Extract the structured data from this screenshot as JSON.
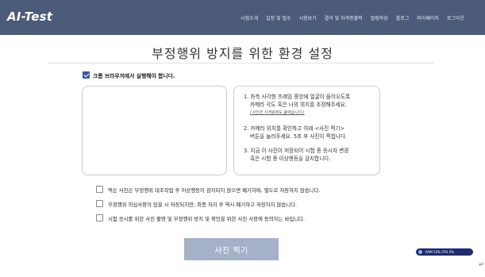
{
  "header": {
    "logo": "AI-Test",
    "nav": [
      "시험소개",
      "일정 및 접수",
      "시험보기",
      "결과 및 자격증출력",
      "알림마당",
      "블로그",
      "마이페이지",
      "로그아웃"
    ]
  },
  "page_title": "부정행위 방지를 위한 환경 설정",
  "browser_notice": {
    "label": "크롬 브라우저에서 실행해야 합니다.",
    "checked": true
  },
  "instructions": {
    "step1": "1. 좌측 사각형 프레임 중앙에 얼굴이 들어오도록",
    "step1b": "카메라 각도 혹은 나의 위치를 조정해주세요.",
    "step1_note": "(사진은 자격증에도 출력됩니다.)",
    "step2": "2. 카메라 위치를 확인하고 아래 <사진 찍기>",
    "step2b": "버튼을 눌러주세요. 5초 후 사진이 찍힙니다.",
    "step3": "3. 지금 이 사진이 저장되어 시험 중 응시자 변경",
    "step3b": "혹은 시험 중 이상행동을 감지합니다."
  },
  "agreements": [
    {
      "label": "찍은 사진은 부정행위 대조작업 후 이상행동이 감지되지 않으면 폐기하며, 별도로 저장하지 않습니다.",
      "checked": false
    },
    {
      "label": "부정행위 의심사항이 있을 시 저장되지만, 최종 처리 후 역시 폐기하고 저장하지 않습니다.",
      "checked": false
    },
    {
      "label": "시험 응시를 위한 사진 촬영 및 부정행위 방지 및 확인을 위한 사진 사용에 동의하는 바입니다.",
      "checked": false
    }
  ],
  "capture_button": "사진 찍기",
  "status_pill": "RAM 53%  CPU 3%",
  "enter_glyph": "↵",
  "colors": {
    "header_bg": "#4b5b79",
    "checkbox_on": "#3a56a8",
    "button_bg": "#a4b1c8",
    "pill_bg": "#1e2c6e"
  }
}
